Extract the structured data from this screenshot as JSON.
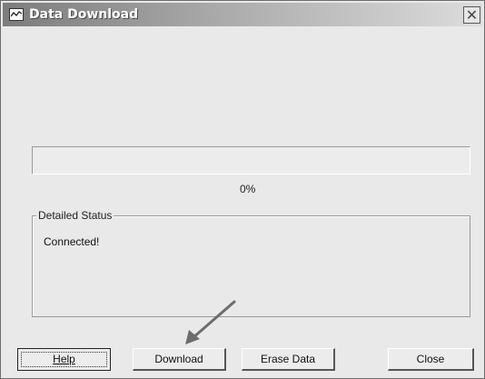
{
  "window": {
    "title": "Data Download",
    "close_glyph": "✕"
  },
  "icons": {
    "app": "chart-window-icon",
    "close": "close-icon"
  },
  "progress": {
    "value_percent": 0,
    "label": "0%"
  },
  "status_group": {
    "title": "Detailed Status",
    "message": "Connected!"
  },
  "buttons": {
    "help": "Help",
    "download": "Download",
    "erase": "Erase Data",
    "close": "Close"
  }
}
